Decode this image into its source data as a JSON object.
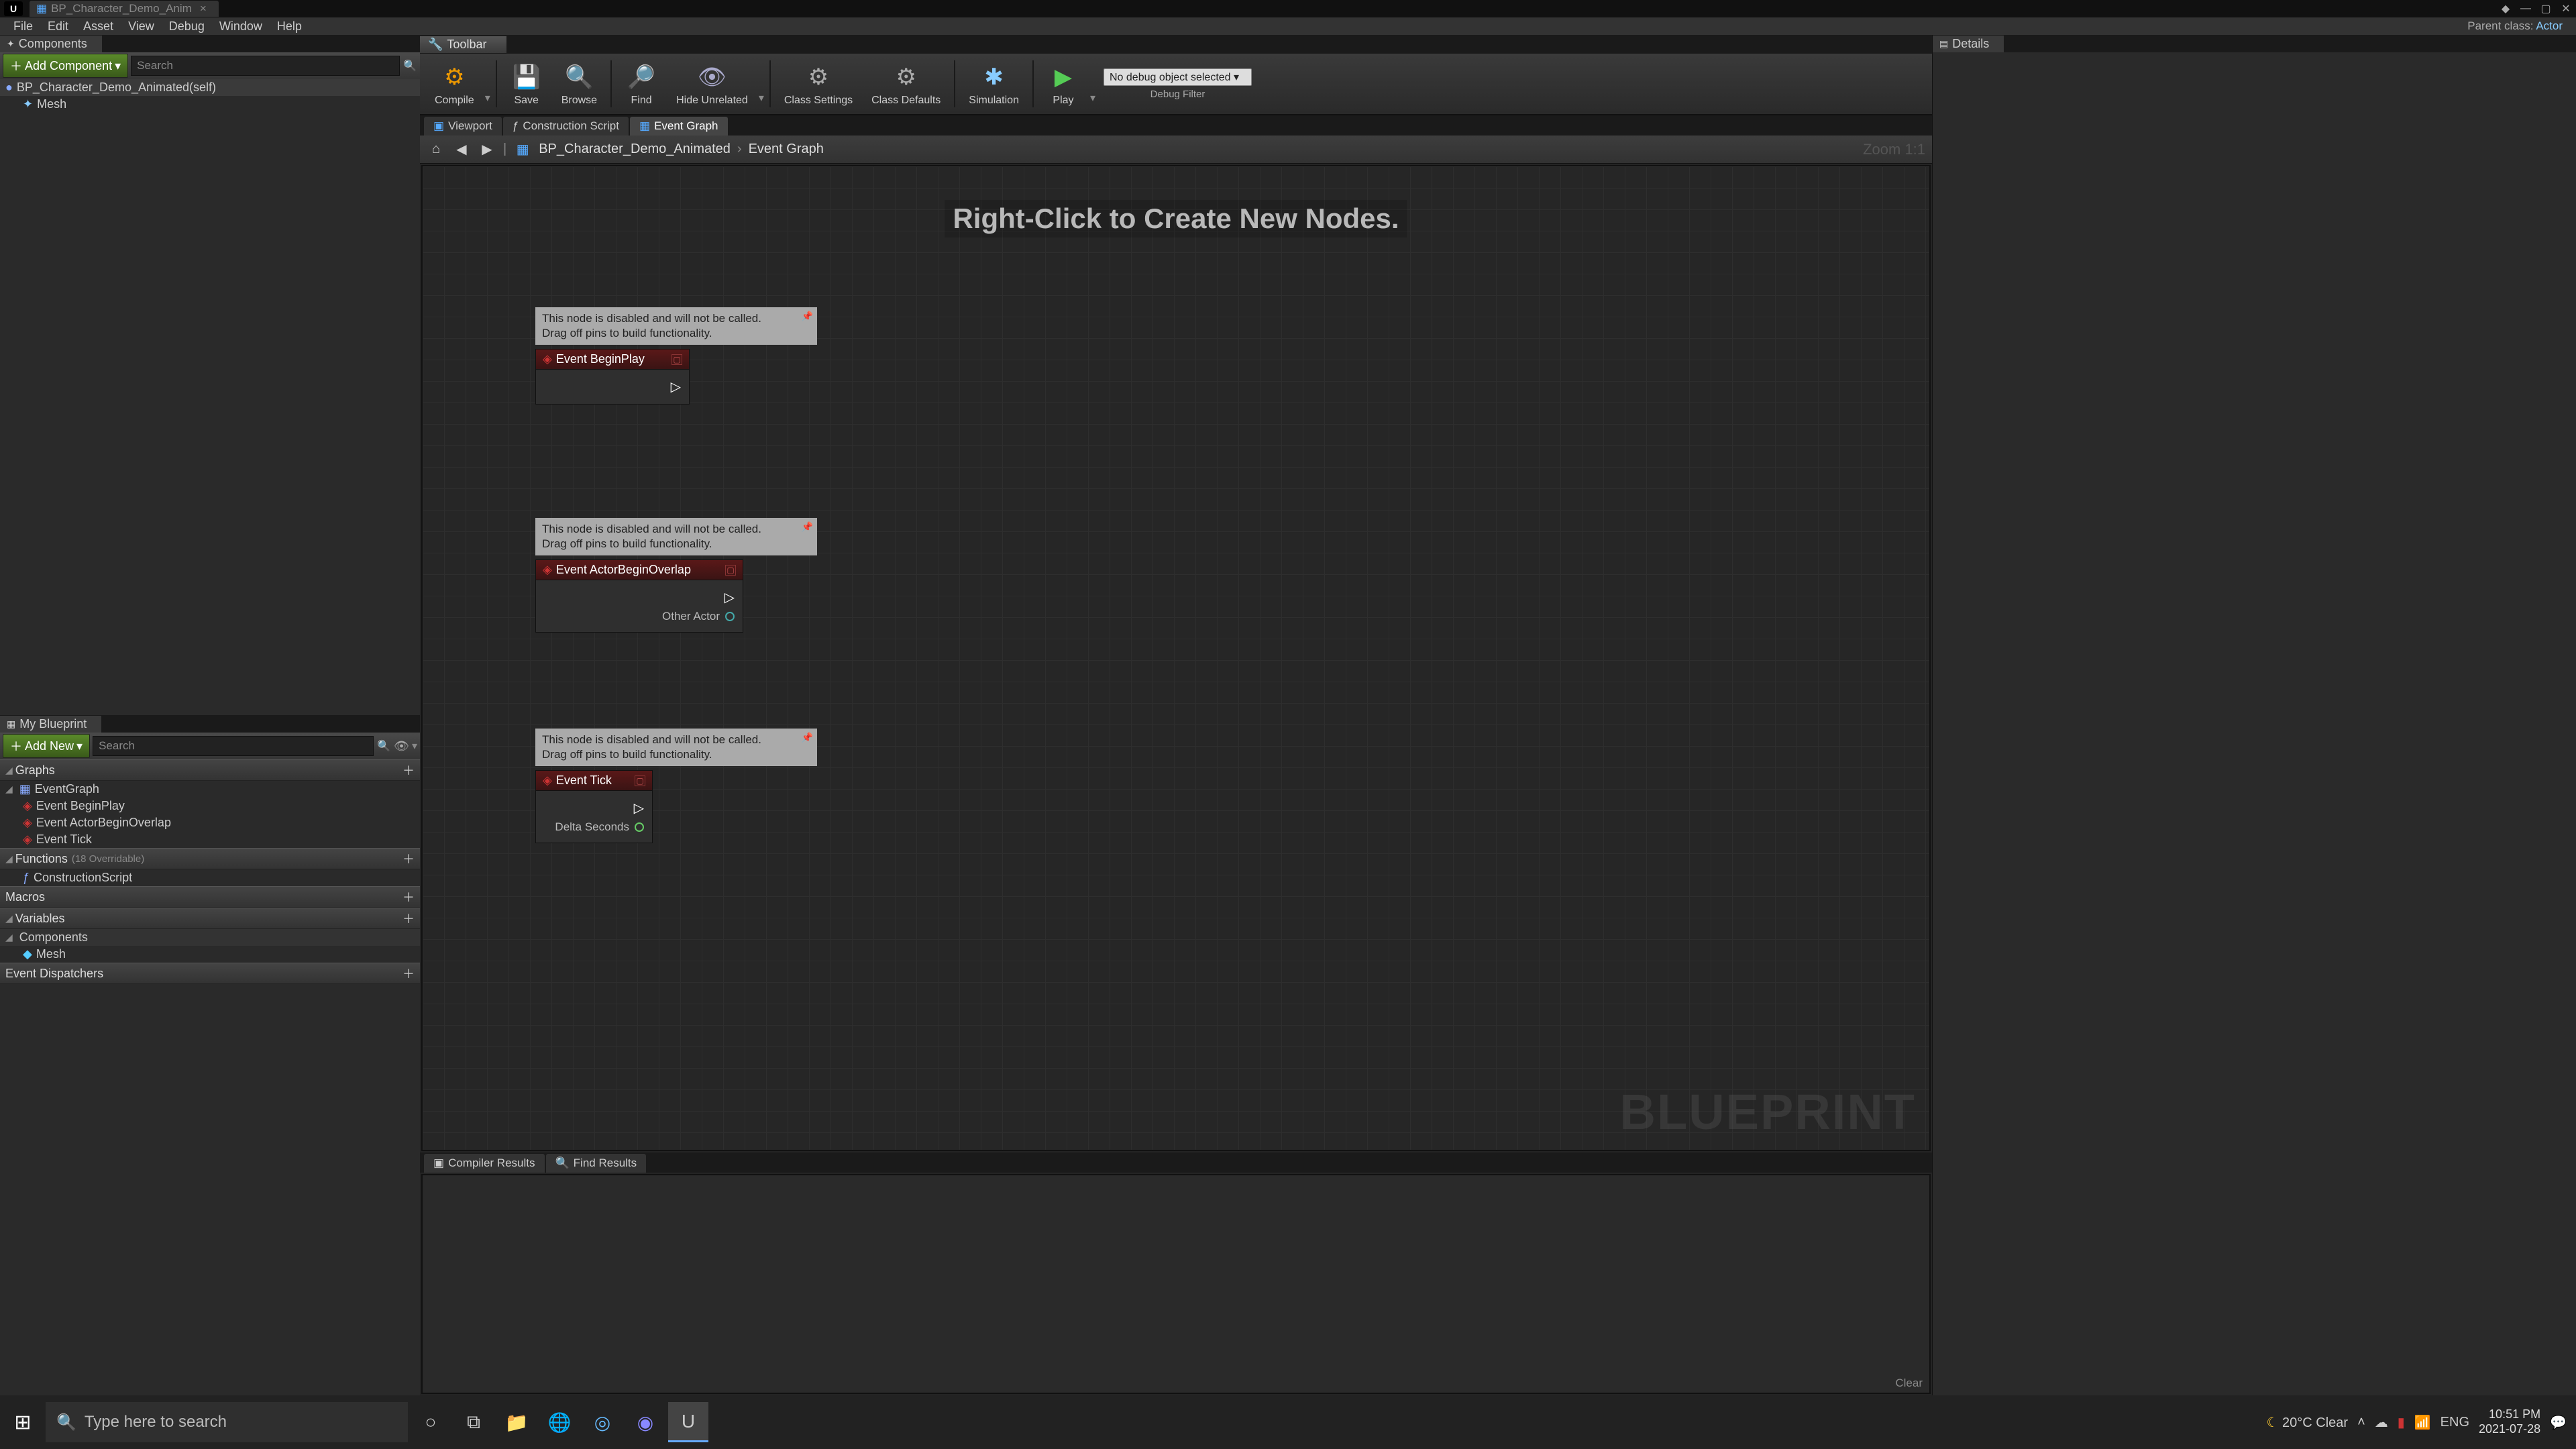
{
  "titlebar": {
    "tab": "BP_Character_Demo_Anim"
  },
  "menu": {
    "items": [
      "File",
      "Edit",
      "Asset",
      "View",
      "Debug",
      "Window",
      "Help"
    ],
    "parent_label": "Parent class:",
    "parent_value": "Actor"
  },
  "components_panel": {
    "title": "Components",
    "add_btn": "Add Component",
    "search_ph": "Search",
    "root": "BP_Character_Demo_Animated(self)",
    "child1": "Mesh"
  },
  "myblueprint": {
    "title": "My Blueprint",
    "add_btn": "Add New",
    "search_ph": "Search",
    "graphs": "Graphs",
    "eventgraph": "EventGraph",
    "ev1": "Event BeginPlay",
    "ev2": "Event ActorBeginOverlap",
    "ev3": "Event Tick",
    "functions": "Functions",
    "func_note": "(18 Overridable)",
    "construction": "ConstructionScript",
    "macros": "Macros",
    "variables": "Variables",
    "components": "Components",
    "mesh": "Mesh",
    "dispatchers": "Event Dispatchers"
  },
  "toolbar": {
    "title": "Toolbar",
    "compile": "Compile",
    "save": "Save",
    "browse": "Browse",
    "find": "Find",
    "hide": "Hide Unrelated",
    "settings": "Class Settings",
    "defaults": "Class Defaults",
    "sim": "Simulation",
    "play": "Play",
    "debug_sel": "No debug object selected",
    "debug_lbl": "Debug Filter"
  },
  "subtabs": {
    "viewport": "Viewport",
    "construction": "Construction Script",
    "eventgraph": "Event Graph"
  },
  "breadcrumb": {
    "root": "BP_Character_Demo_Animated",
    "leaf": "Event Graph",
    "zoom": "Zoom 1:1"
  },
  "graph": {
    "caption": "Right-Click to Create New Nodes.",
    "watermark": "BLUEPRINT",
    "disabled_l1": "This node is disabled and will not be called.",
    "disabled_l2": "Drag off pins to build functionality.",
    "node1_title": "Event BeginPlay",
    "node2_title": "Event ActorBeginOverlap",
    "node2_pin": "Other Actor",
    "node3_title": "Event Tick",
    "node3_pin": "Delta Seconds"
  },
  "bottom": {
    "compiler": "Compiler Results",
    "find": "Find Results",
    "clear": "Clear"
  },
  "details": {
    "title": "Details"
  },
  "taskbar": {
    "search_ph": "Type here to search",
    "weather": "20°C  Clear",
    "lang": "ENG",
    "time": "10:51 PM",
    "date": "2021-07-28"
  }
}
